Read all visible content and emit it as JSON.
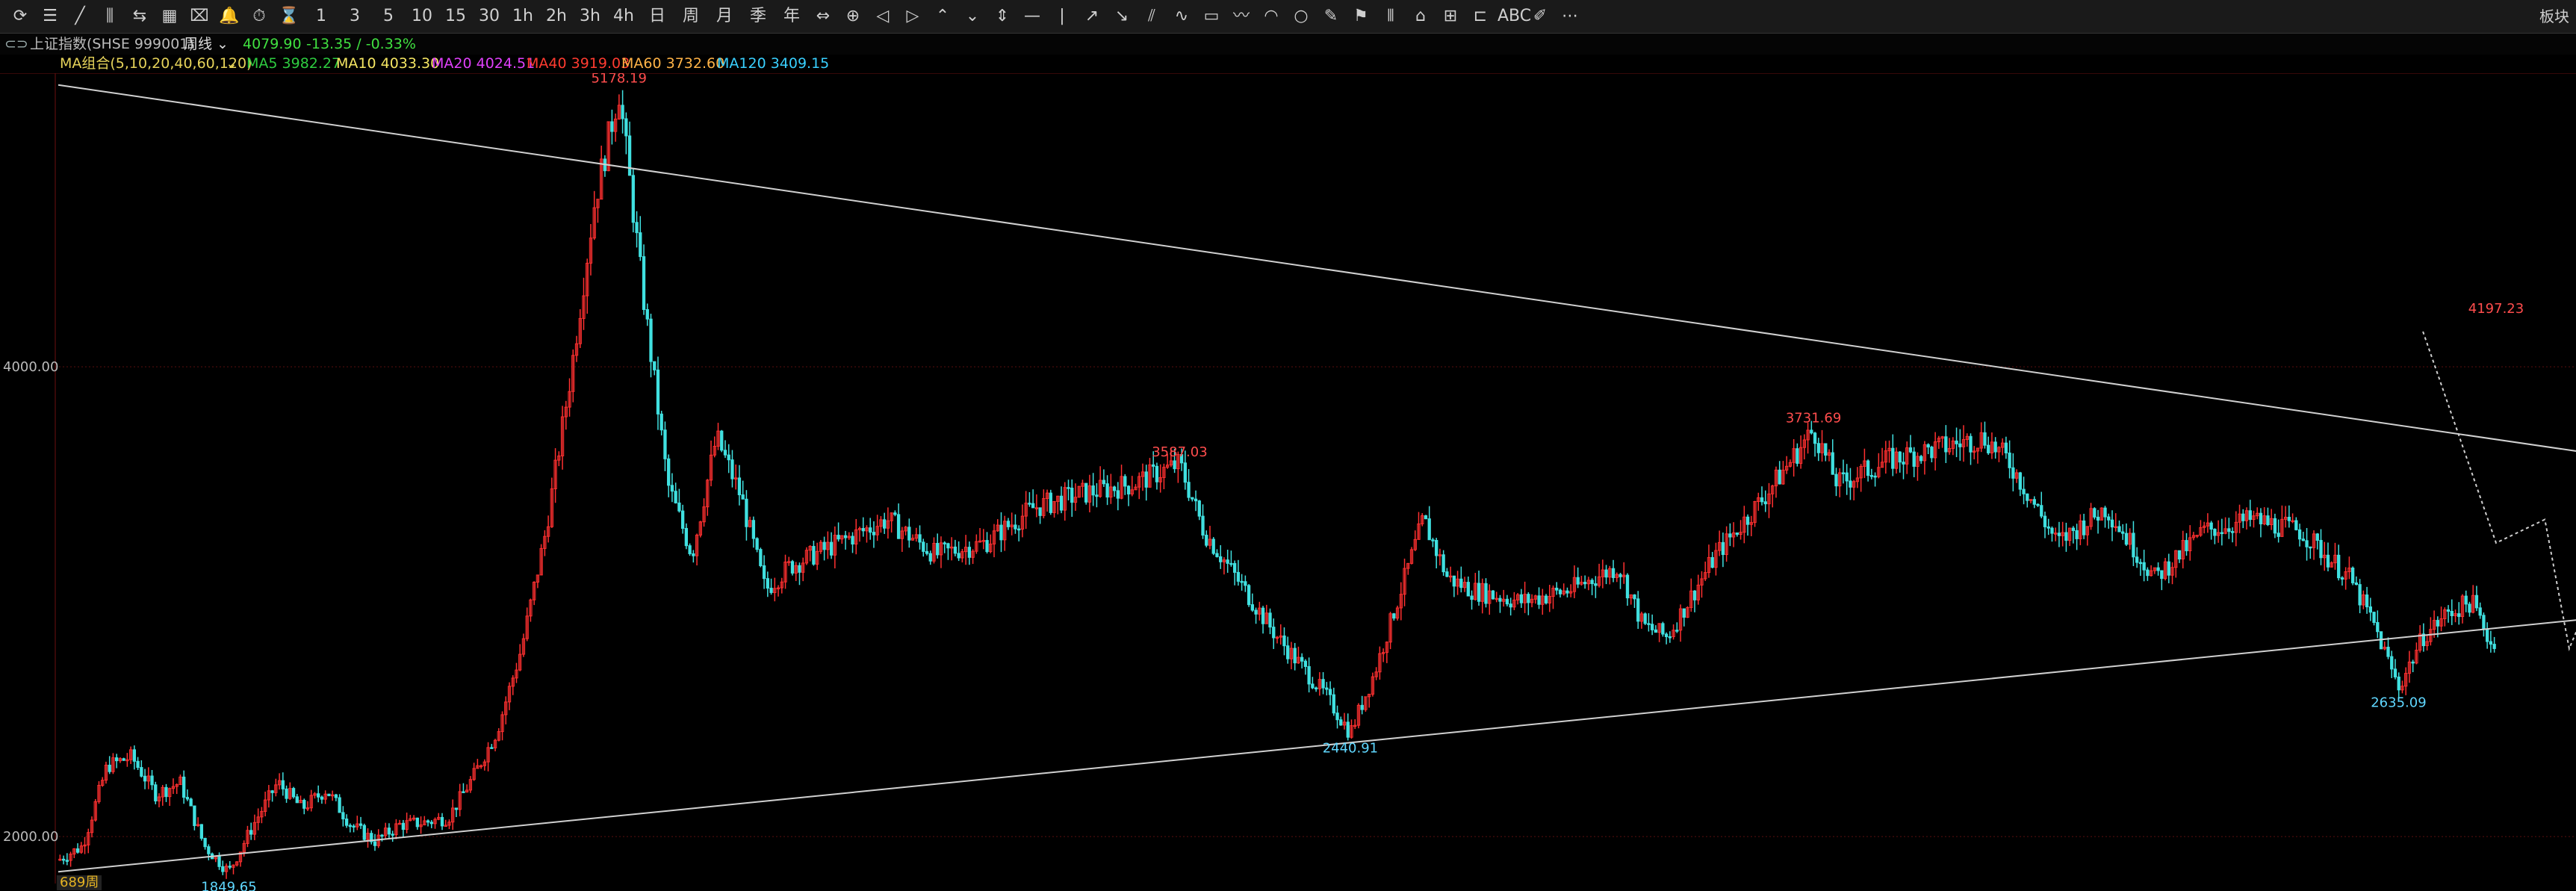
{
  "toolbar": {
    "timeframes": [
      "1",
      "3",
      "5",
      "10",
      "15",
      "30",
      "1h",
      "2h",
      "3h",
      "4h",
      "日",
      "周",
      "月",
      "季",
      "年"
    ],
    "right_label": "板块",
    "icons": [
      "refresh-icon",
      "list-icon",
      "line-chart-icon",
      "candle-icon",
      "compare-icon",
      "chart-layout-icon",
      "screenshot-icon",
      "bell-icon",
      "time-share-icon",
      "cycle-icon",
      "pan-icon",
      "zoom-icon",
      "prev-icon",
      "next-icon",
      "up-icon",
      "down-icon",
      "cursor-icon",
      "hline-icon",
      "vline-icon",
      "ray-icon",
      "arrow-icon",
      "parallel-icon",
      "wave-icon",
      "rect-icon",
      "wave2-icon",
      "arc-icon",
      "circle-icon",
      "note-icon",
      "flag-icon",
      "fib-icon",
      "house-icon",
      "ruler-icon",
      "price-range-icon",
      "text-icon",
      "brush-icon",
      "more-icon"
    ]
  },
  "infobar": {
    "symbol": "上证指数(SHSE 999001)",
    "period": "周线",
    "price": "4079.90",
    "change": "-13.35 / -0.33%"
  },
  "legend": {
    "group": "MA组合(5,10,20,40,60,120)",
    "items": [
      {
        "label": "MA5",
        "value": "3982.27",
        "color": "#2ecc40"
      },
      {
        "label": "MA10",
        "value": "4033.30",
        "color": "#f5e663"
      },
      {
        "label": "MA20",
        "value": "4024.51",
        "color": "#e040fb"
      },
      {
        "label": "MA40",
        "value": "3919.03",
        "color": "#ff3b30"
      },
      {
        "label": "MA60",
        "value": "3732.60",
        "color": "#ffb347"
      },
      {
        "label": "MA120",
        "value": "3409.15",
        "color": "#39d0ff"
      }
    ]
  },
  "chart_data": {
    "type": "candlestick",
    "ylim": [
      1800,
      5250
    ],
    "y_ticks": [
      "4000.00",
      "2000.00"
    ],
    "y_tick_values": [
      4000,
      2000
    ],
    "x_range": [
      0,
      100
    ],
    "bar_count_label": "689周",
    "grid": false,
    "colors": {
      "up": "#ff3030",
      "down": "#40e0e0",
      "trend": "#d0d0d0",
      "high_label": "#ff4d4d",
      "low_label": "#5fd7ff"
    },
    "path_points": [
      [
        0,
        1900
      ],
      [
        1,
        1960
      ],
      [
        2,
        2300
      ],
      [
        3,
        2340
      ],
      [
        4,
        2180
      ],
      [
        5,
        2230
      ],
      [
        6,
        1960
      ],
      [
        7,
        1849.65
      ],
      [
        8,
        2050
      ],
      [
        9,
        2230
      ],
      [
        10,
        2120
      ],
      [
        11,
        2200
      ],
      [
        12,
        2050
      ],
      [
        13,
        1980
      ],
      [
        14,
        2050
      ],
      [
        15,
        2060
      ],
      [
        16,
        2080
      ],
      [
        17,
        2250
      ],
      [
        18,
        2450
      ],
      [
        19,
        2800
      ],
      [
        20,
        3300
      ],
      [
        21,
        3950
      ],
      [
        22,
        4700
      ],
      [
        23,
        5178.19
      ],
      [
        24,
        4300
      ],
      [
        25,
        3500
      ],
      [
        26,
        3200
      ],
      [
        27,
        3700
      ],
      [
        28,
        3450
      ],
      [
        29,
        3050
      ],
      [
        30,
        3150
      ],
      [
        32,
        3250
      ],
      [
        34,
        3350
      ],
      [
        36,
        3200
      ],
      [
        38,
        3250
      ],
      [
        40,
        3400
      ],
      [
        42,
        3460
      ],
      [
        44,
        3500
      ],
      [
        46,
        3587.03
      ],
      [
        47,
        3300
      ],
      [
        48,
        3150
      ],
      [
        50,
        2850
      ],
      [
        52,
        2600
      ],
      [
        53,
        2440.91
      ],
      [
        54,
        2700
      ],
      [
        56,
        3350
      ],
      [
        57,
        3100
      ],
      [
        58,
        3050
      ],
      [
        60,
        3000
      ],
      [
        62,
        3050
      ],
      [
        64,
        3150
      ],
      [
        65,
        2900
      ],
      [
        66,
        2850
      ],
      [
        68,
        3200
      ],
      [
        70,
        3450
      ],
      [
        72,
        3731.69
      ],
      [
        73,
        3500
      ],
      [
        75,
        3600
      ],
      [
        77,
        3650
      ],
      [
        79,
        3700
      ],
      [
        80,
        3600
      ],
      [
        82,
        3250
      ],
      [
        84,
        3400
      ],
      [
        86,
        3100
      ],
      [
        88,
        3300
      ],
      [
        90,
        3350
      ],
      [
        92,
        3300
      ],
      [
        94,
        3100
      ],
      [
        95,
        2900
      ],
      [
        96,
        2635.09
      ],
      [
        97,
        2850
      ],
      [
        98,
        2950
      ],
      [
        99,
        3000
      ],
      [
        100,
        2780
      ]
    ],
    "extremes": [
      {
        "label": "5178.19",
        "x": 23,
        "y": 5178.19,
        "kind": "high"
      },
      {
        "label": "3587.03",
        "x": 46,
        "y": 3587.03,
        "kind": "high"
      },
      {
        "label": "3731.69",
        "x": 72,
        "y": 3731.69,
        "kind": "high"
      },
      {
        "label": "4197.23",
        "x": 100,
        "y": 4197.23,
        "kind": "high"
      },
      {
        "label": "1849.65",
        "x": 7,
        "y": 1849.65,
        "kind": "low"
      },
      {
        "label": "2440.91",
        "x": 53,
        "y": 2440.91,
        "kind": "low"
      },
      {
        "label": "2635.09",
        "x": 96,
        "y": 2635.09,
        "kind": "low"
      }
    ],
    "trendlines": [
      {
        "name": "upper",
        "points": [
          [
            0,
            5200
          ],
          [
            100,
            3600
          ]
        ]
      },
      {
        "name": "lower",
        "points": [
          [
            0,
            1850
          ],
          [
            100,
            2950
          ]
        ]
      }
    ],
    "projection": [
      [
        97,
        4150
      ],
      [
        100,
        3250
      ],
      [
        102,
        3350
      ],
      [
        103,
        2800
      ],
      [
        104,
        3050
      ]
    ]
  }
}
